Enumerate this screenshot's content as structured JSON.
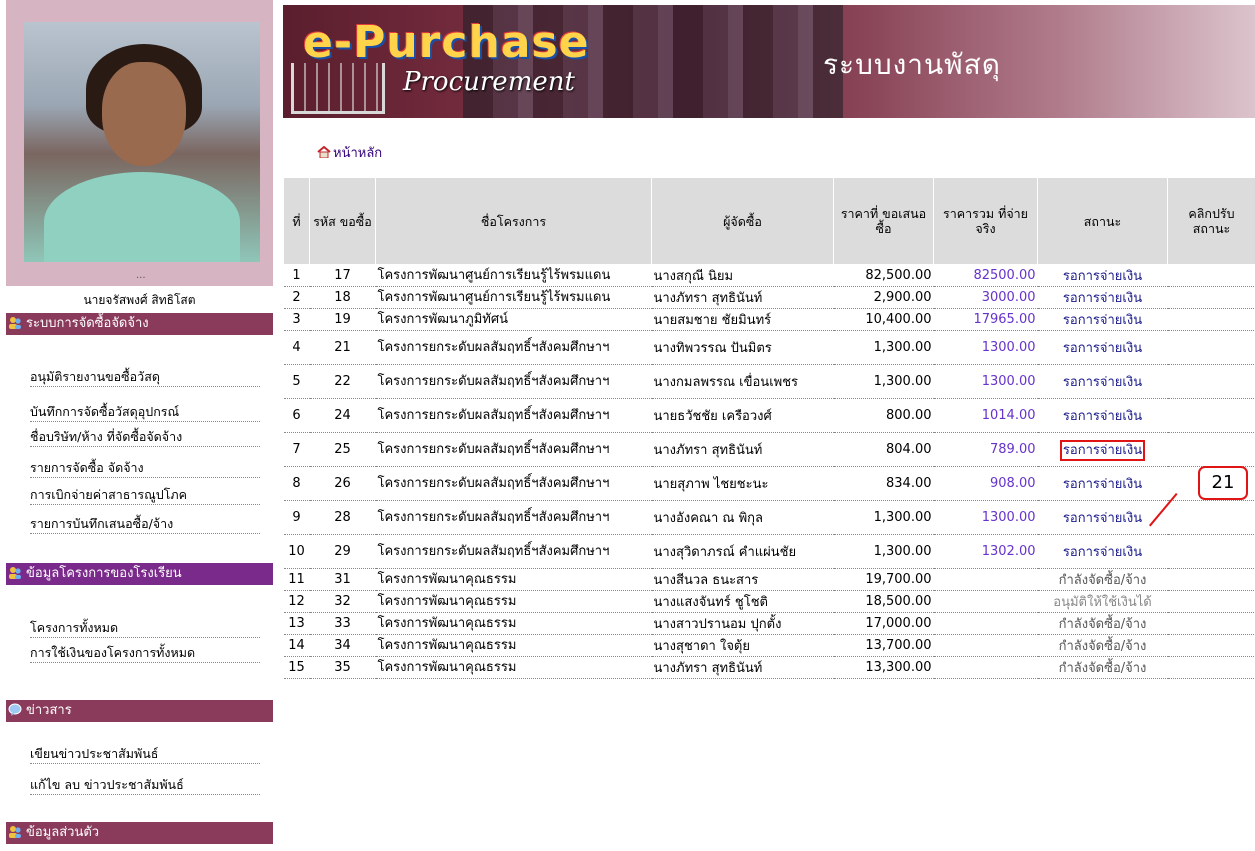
{
  "sidebar": {
    "owner_name": "นายจรัสพงศ์ สิทธิโสต",
    "photo_dots": "...",
    "sections": [
      {
        "title": "ระบบการจัดซื้อจัดจ้าง",
        "items": [
          "อนุมัติรายงานขอซื้อวัสดุ",
          "บันทึกการจัดซื้อวัสดุอุปกรณ์",
          "ชื่อบริษัท/ห้าง ที่จัดซื้อจัดจ้าง",
          "รายการจัดซื้อ จัดจ้าง",
          "การเบิกจ่ายค่าสาธารณูปโภค",
          "รายการบันทึกเสนอซื้อ/จ้าง"
        ]
      },
      {
        "title": "ข้อมูลโครงการของโรงเรียน",
        "items": [
          "โครงการทั้งหมด",
          "การใช้เงินของโครงการทั้งหมด"
        ]
      },
      {
        "title": "ข่าวสาร",
        "items": [
          "เขียนข่าวประชาสัมพันธ์",
          "แก้ไข ลบ ข่าวประชาสัมพันธ์"
        ]
      },
      {
        "title": "ข้อมูลส่วนตัว",
        "items": []
      }
    ]
  },
  "banner": {
    "logo_main": "e-Purchase",
    "logo_sub": "Procurement",
    "system_title": "ระบบงานพัสดุ"
  },
  "home_link": "หน้าหลัก",
  "table": {
    "headers": {
      "no": "ที่",
      "code": "รหัส ขอซื้อ",
      "project": "ชื่อโครงการ",
      "buyer": "ผู้จัดซื้อ",
      "proposed": "ราคาที่ ขอเสนอซื้อ",
      "actual": "ราคารวม ที่จ่ายจริง",
      "status": "สถานะ",
      "change": "คลิกปรับ สถานะ"
    },
    "rows": [
      {
        "no": "1",
        "code": "17",
        "project": "โครงการพัฒนาศูนย์การเรียนรู้ไร้พรมแดน",
        "buyer": "นางสกุณี นิยม",
        "proposed": "82,500.00",
        "actual": "82500.00",
        "status": "รอการจ่ายเงิน"
      },
      {
        "no": "2",
        "code": "18",
        "project": "โครงการพัฒนาศูนย์การเรียนรู้ไร้พรมแดน",
        "buyer": "นางภัทรา สุทธินันท์",
        "proposed": "2,900.00",
        "actual": "3000.00",
        "status": "รอการจ่ายเงิน"
      },
      {
        "no": "3",
        "code": "19",
        "project": "โครงการพัฒนาภูมิทัศน์",
        "buyer": "นายสมชาย ชัยมินทร์",
        "proposed": "10,400.00",
        "actual": "17965.00",
        "status": "รอการจ่ายเงิน"
      },
      {
        "no": "4",
        "code": "21",
        "project": "โครงการยกระดับผลสัมฤทธิ์ฯสังคมศึกษาฯ",
        "buyer": "นางทิพวรรณ ปันมิตร",
        "proposed": "1,300.00",
        "actual": "1300.00",
        "status": "รอการจ่ายเงิน"
      },
      {
        "no": "5",
        "code": "22",
        "project": "โครงการยกระดับผลสัมฤทธิ์ฯสังคมศึกษาฯ",
        "buyer": "นางกมลพรรณ เขื่อนเพชร",
        "proposed": "1,300.00",
        "actual": "1300.00",
        "status": "รอการจ่ายเงิน"
      },
      {
        "no": "6",
        "code": "24",
        "project": "โครงการยกระดับผลสัมฤทธิ์ฯสังคมศึกษาฯ",
        "buyer": "นายธวัชชัย เครือวงศ์",
        "proposed": "800.00",
        "actual": "1014.00",
        "status": "รอการจ่ายเงิน"
      },
      {
        "no": "7",
        "code": "25",
        "project": "โครงการยกระดับผลสัมฤทธิ์ฯสังคมศึกษาฯ",
        "buyer": "นางภัทรา สุทธินันท์",
        "proposed": "804.00",
        "actual": "789.00",
        "status": "รอการจ่ายเงิน"
      },
      {
        "no": "8",
        "code": "26",
        "project": "โครงการยกระดับผลสัมฤทธิ์ฯสังคมศึกษาฯ",
        "buyer": "นายสุภาพ ไชยชะนะ",
        "proposed": "834.00",
        "actual": "908.00",
        "status": "รอการจ่ายเงิน"
      },
      {
        "no": "9",
        "code": "28",
        "project": "โครงการยกระดับผลสัมฤทธิ์ฯสังคมศึกษาฯ",
        "buyer": "นางอังคณา ณ พิกุล",
        "proposed": "1,300.00",
        "actual": "1300.00",
        "status": "รอการจ่ายเงิน"
      },
      {
        "no": "10",
        "code": "29",
        "project": "โครงการยกระดับผลสัมฤทธิ์ฯสังคมศึกษาฯ",
        "buyer": "นางสุวิดาภรณ์ คำแผ่นชัย",
        "proposed": "1,300.00",
        "actual": "1302.00",
        "status": "รอการจ่ายเงิน"
      },
      {
        "no": "11",
        "code": "31",
        "project": "โครงการพัฒนาคุณธรรม",
        "buyer": "นางสีนวล ธนะสาร",
        "proposed": "19,700.00",
        "actual": "",
        "status": "กำลังจัดซื้อ/จ้าง"
      },
      {
        "no": "12",
        "code": "32",
        "project": "โครงการพัฒนาคุณธรรม",
        "buyer": "นางแสงจันทร์ ชูโชติ",
        "proposed": "18,500.00",
        "actual": "",
        "status": "อนุมัติให้ใช้เงินได้"
      },
      {
        "no": "13",
        "code": "33",
        "project": "โครงการพัฒนาคุณธรรม",
        "buyer": "นางสาวปรานอม ปุกตั้ง",
        "proposed": "17,000.00",
        "actual": "",
        "status": "กำลังจัดซื้อ/จ้าง"
      },
      {
        "no": "14",
        "code": "34",
        "project": "โครงการพัฒนาคุณธรรม",
        "buyer": "นางสุชาดา ใจตุ้ย",
        "proposed": "13,700.00",
        "actual": "",
        "status": "กำลังจัดซื้อ/จ้าง"
      },
      {
        "no": "15",
        "code": "35",
        "project": "โครงการพัฒนาคุณธรรม",
        "buyer": "นางภัทรา สุทธินันท์",
        "proposed": "13,300.00",
        "actual": "",
        "status": "กำลังจัดซื้อ/จ้าง"
      }
    ]
  },
  "annotation": {
    "label": "21"
  },
  "colors": {
    "menu_head": "#8a3a5a",
    "menu_head_alt": "#7a2a8a",
    "status_link": "#1a1a8a",
    "actual_price": "#6633cc",
    "highlight": "#e01414"
  }
}
